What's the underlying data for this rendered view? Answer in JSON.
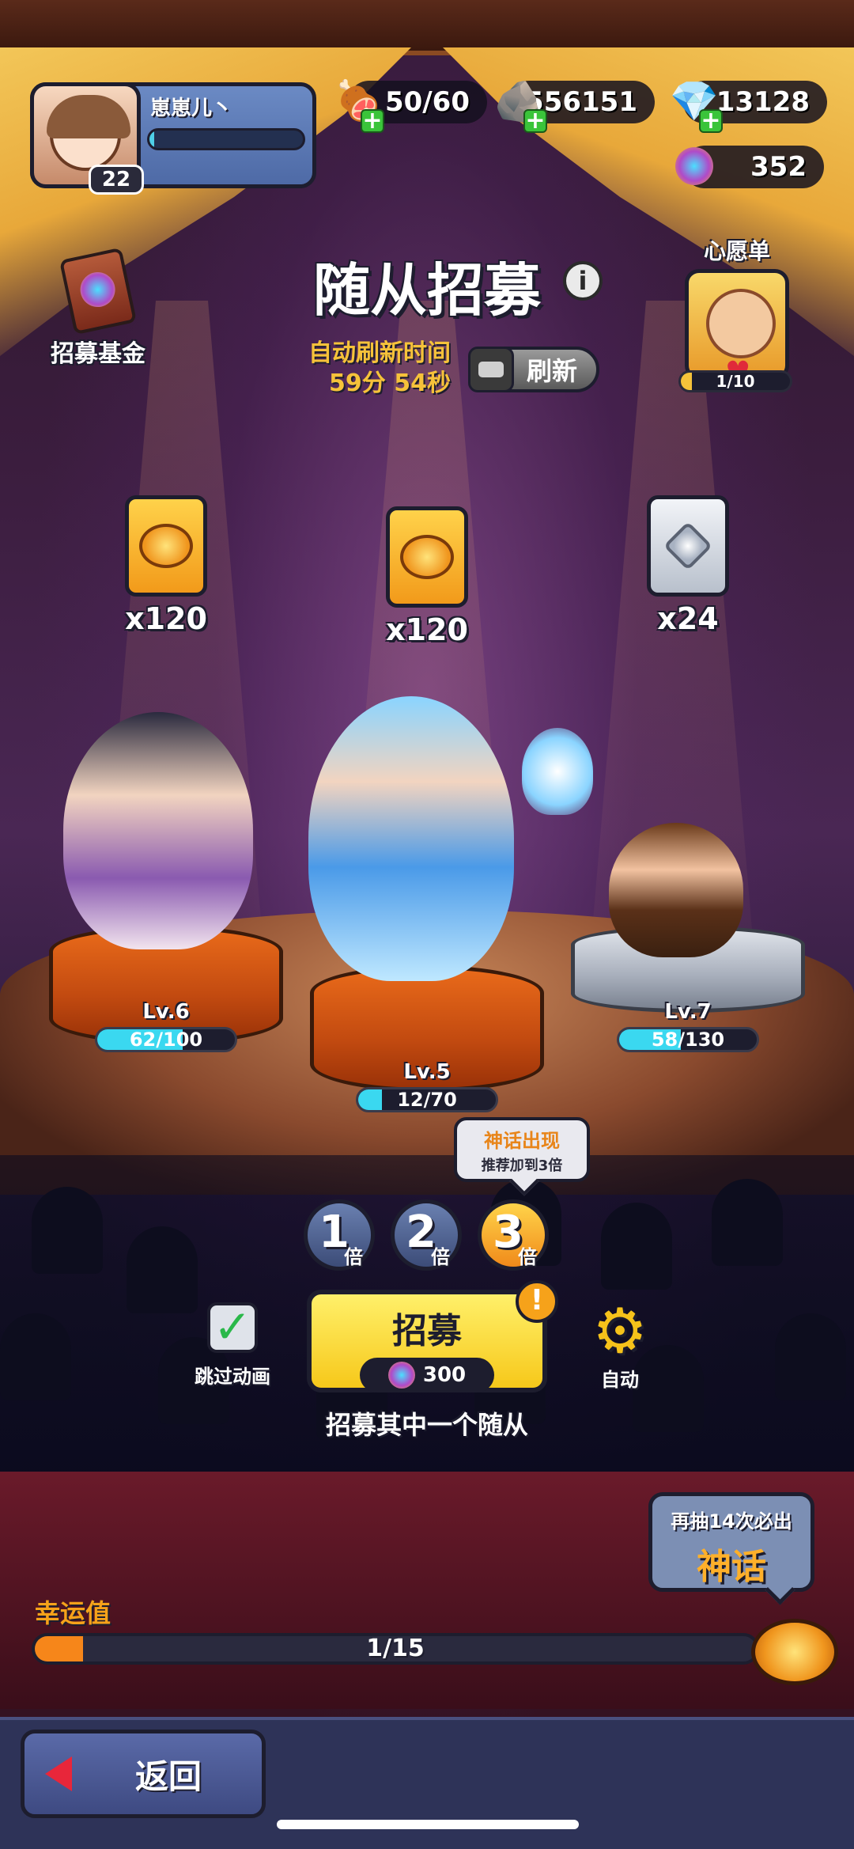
{
  "player": {
    "name": "崽崽儿丶",
    "level": "22",
    "xp_fraction": 0.03
  },
  "resources": {
    "meat": "50/60",
    "silver": "556151",
    "diamond": "13128",
    "token": "352"
  },
  "header": {
    "title": "随从招募",
    "info_icon": "i"
  },
  "fund": {
    "label": "招募基金"
  },
  "refresh": {
    "label": "自动刷新时间",
    "countdown": "59分 54秒",
    "button_label": "刷新"
  },
  "wishlist": {
    "label": "心愿单",
    "progress": "1/10",
    "progress_fraction": 0.1
  },
  "rewards": [
    {
      "type": "gold",
      "qty": "x120"
    },
    {
      "type": "gold",
      "qty": "x120"
    },
    {
      "type": "silver",
      "qty": "x24"
    }
  ],
  "heroes": [
    {
      "level": "Lv.6",
      "progress": "62/100",
      "fraction": 0.62
    },
    {
      "level": "Lv.5",
      "progress": "12/70",
      "fraction": 0.17
    },
    {
      "level": "Lv.7",
      "progress": "58/130",
      "fraction": 0.45
    }
  ],
  "multiplier": {
    "tip_title": "神话出现",
    "tip_sub": "推荐加到3倍",
    "options": [
      {
        "num": "1",
        "unit": "倍"
      },
      {
        "num": "2",
        "unit": "倍"
      },
      {
        "num": "3",
        "unit": "倍"
      }
    ],
    "selected": "3"
  },
  "actions": {
    "skip_label": "跳过动画",
    "skip_checked": true,
    "recruit_label": "招募",
    "recruit_cost": "300",
    "alert": "!",
    "auto_label": "自动",
    "recruit_desc": "招募其中一个随从"
  },
  "guarantee": {
    "line1": "再抽14次必出",
    "line2": "神话"
  },
  "luck": {
    "label": "幸运值",
    "progress": "1/15",
    "fraction": 0.067
  },
  "footer": {
    "back_label": "返回"
  },
  "colors": {
    "accent_gold": "#f6c21a",
    "progress_cyan": "#3ad8f0",
    "luck_orange": "#f6861a",
    "alert_red": "#e8263a"
  }
}
